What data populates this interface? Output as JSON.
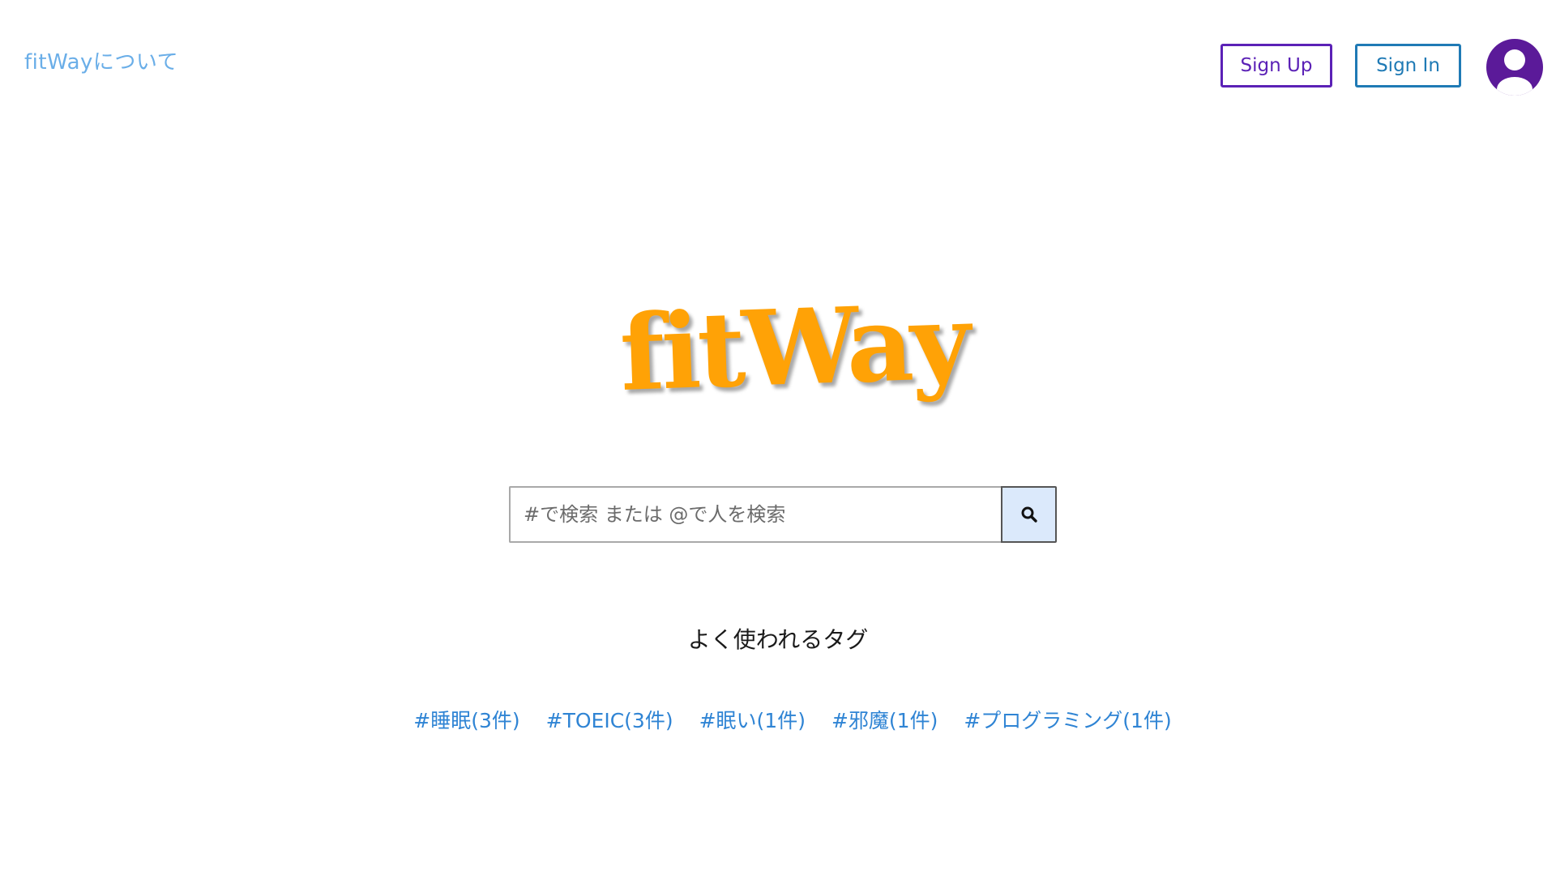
{
  "header": {
    "about_label": "fitWayについて",
    "signup_label": "Sign Up",
    "signin_label": "Sign In",
    "avatar_icon": "user-avatar-icon"
  },
  "logo": {
    "text": "fitWay"
  },
  "search": {
    "placeholder": "#で検索 または @で人を検索",
    "value": "",
    "button_icon": "search-icon"
  },
  "popular_tags": {
    "heading": "よく使われるタグ",
    "items": [
      {
        "label": "#睡眠(3件)"
      },
      {
        "label": "#TOEIC(3件)"
      },
      {
        "label": "#眠い(1件)"
      },
      {
        "label": "#邪魔(1件)"
      },
      {
        "label": "#プログラミング(1件)"
      }
    ]
  },
  "colors": {
    "accent_orange": "#ffa206",
    "signup_purple": "#5b21b6",
    "signin_blue": "#1f7ab5",
    "avatar_purple": "#5b1a99",
    "link_blue": "#2f84d4",
    "about_link": "#6aaee8",
    "search_button_bg": "#dbe9fb"
  }
}
